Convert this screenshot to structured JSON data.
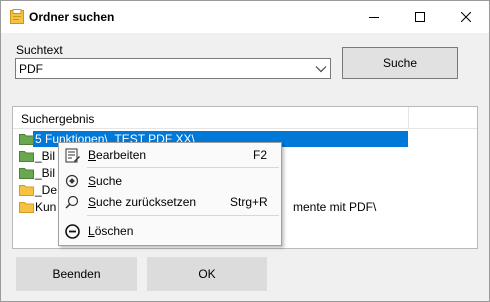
{
  "window": {
    "title": "Ordner suchen",
    "minimize_glyph": "—",
    "maximize_glyph": "☐",
    "close_glyph": "✕"
  },
  "search": {
    "label": "Suchtext",
    "value": "PDF",
    "button_label": "Suche"
  },
  "results": {
    "header": "Suchergebnis",
    "rows": [
      {
        "icon": "folder-green-icon",
        "text": "5 Funktionen\\_TEST PDF XX\\",
        "selected": true
      },
      {
        "icon": "folder-green-icon",
        "text": "_Bil",
        "selected": false
      },
      {
        "icon": "folder-green-icon",
        "text": "_Bil",
        "selected": false
      },
      {
        "icon": "folder-yellow-icon",
        "text": "_De",
        "selected": false
      },
      {
        "icon": "folder-yellow-icon",
        "text": "Kun",
        "tail": "mente mit PDF\\",
        "selected": false
      }
    ]
  },
  "context_menu": {
    "items": [
      {
        "label": "Bearbeiten",
        "underline": "B",
        "rest": "earbeiten",
        "shortcut": "F2",
        "icon": "edit-icon"
      },
      {
        "label": "Suche",
        "underline": "S",
        "rest": "uche",
        "shortcut": "",
        "icon": "search-plus-icon"
      },
      {
        "label": "Suche zurücksetzen",
        "underline": "S",
        "rest": "uche zurücksetzen",
        "shortcut": "Strg+R",
        "icon": "search-icon"
      },
      {
        "label": "Löschen",
        "underline": "L",
        "rest": "öschen",
        "shortcut": "",
        "icon": "delete-icon"
      }
    ]
  },
  "footer": {
    "cancel_label": "Beenden",
    "ok_label": "OK"
  },
  "colors": {
    "selection": "#0078d7",
    "folder_green": "#6aa84f",
    "folder_yellow": "#f5c242"
  }
}
